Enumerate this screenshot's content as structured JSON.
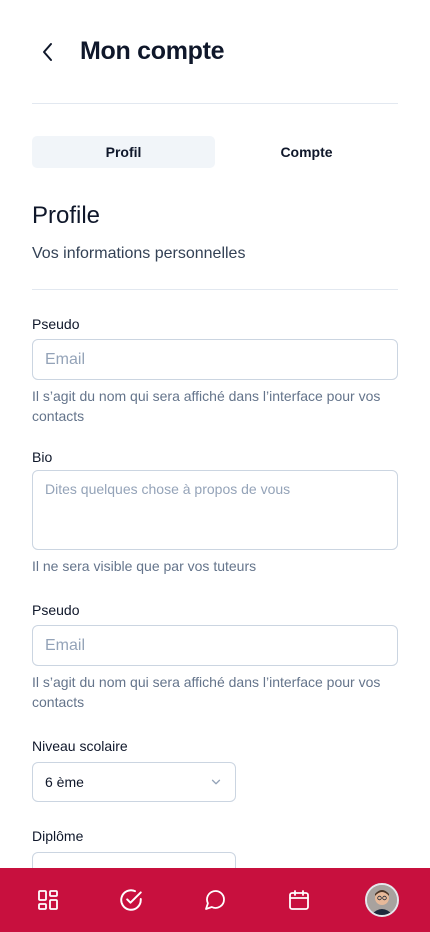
{
  "header": {
    "title": "Mon compte"
  },
  "tabs": [
    {
      "label": "Profil",
      "active": true
    },
    {
      "label": "Compte",
      "active": false
    }
  ],
  "section": {
    "title": "Profile",
    "subtitle": "Vos informations personnelles"
  },
  "fields": {
    "pseudo1": {
      "label": "Pseudo",
      "placeholder": "Email",
      "help": "Il s’agit du nom qui sera affiché dans l’interface pour vos contacts"
    },
    "bio": {
      "label": "Bio",
      "placeholder": "Dites quelques chose à propos de vous",
      "help": "Il ne sera visible que par vos tuteurs"
    },
    "pseudo2": {
      "label": "Pseudo",
      "placeholder": "Email",
      "help": "Il s’agit du nom qui sera affiché dans l’interface pour vos contacts"
    },
    "niveau": {
      "label": "Niveau scolaire",
      "value": "6 ème"
    },
    "diplome": {
      "label": "Diplôme"
    }
  },
  "nav": {
    "items": [
      {
        "icon": "dashboard-icon"
      },
      {
        "icon": "check-circle-icon"
      },
      {
        "icon": "chat-icon"
      },
      {
        "icon": "calendar-icon"
      },
      {
        "icon": "avatar"
      }
    ],
    "color": "#c8103e"
  }
}
